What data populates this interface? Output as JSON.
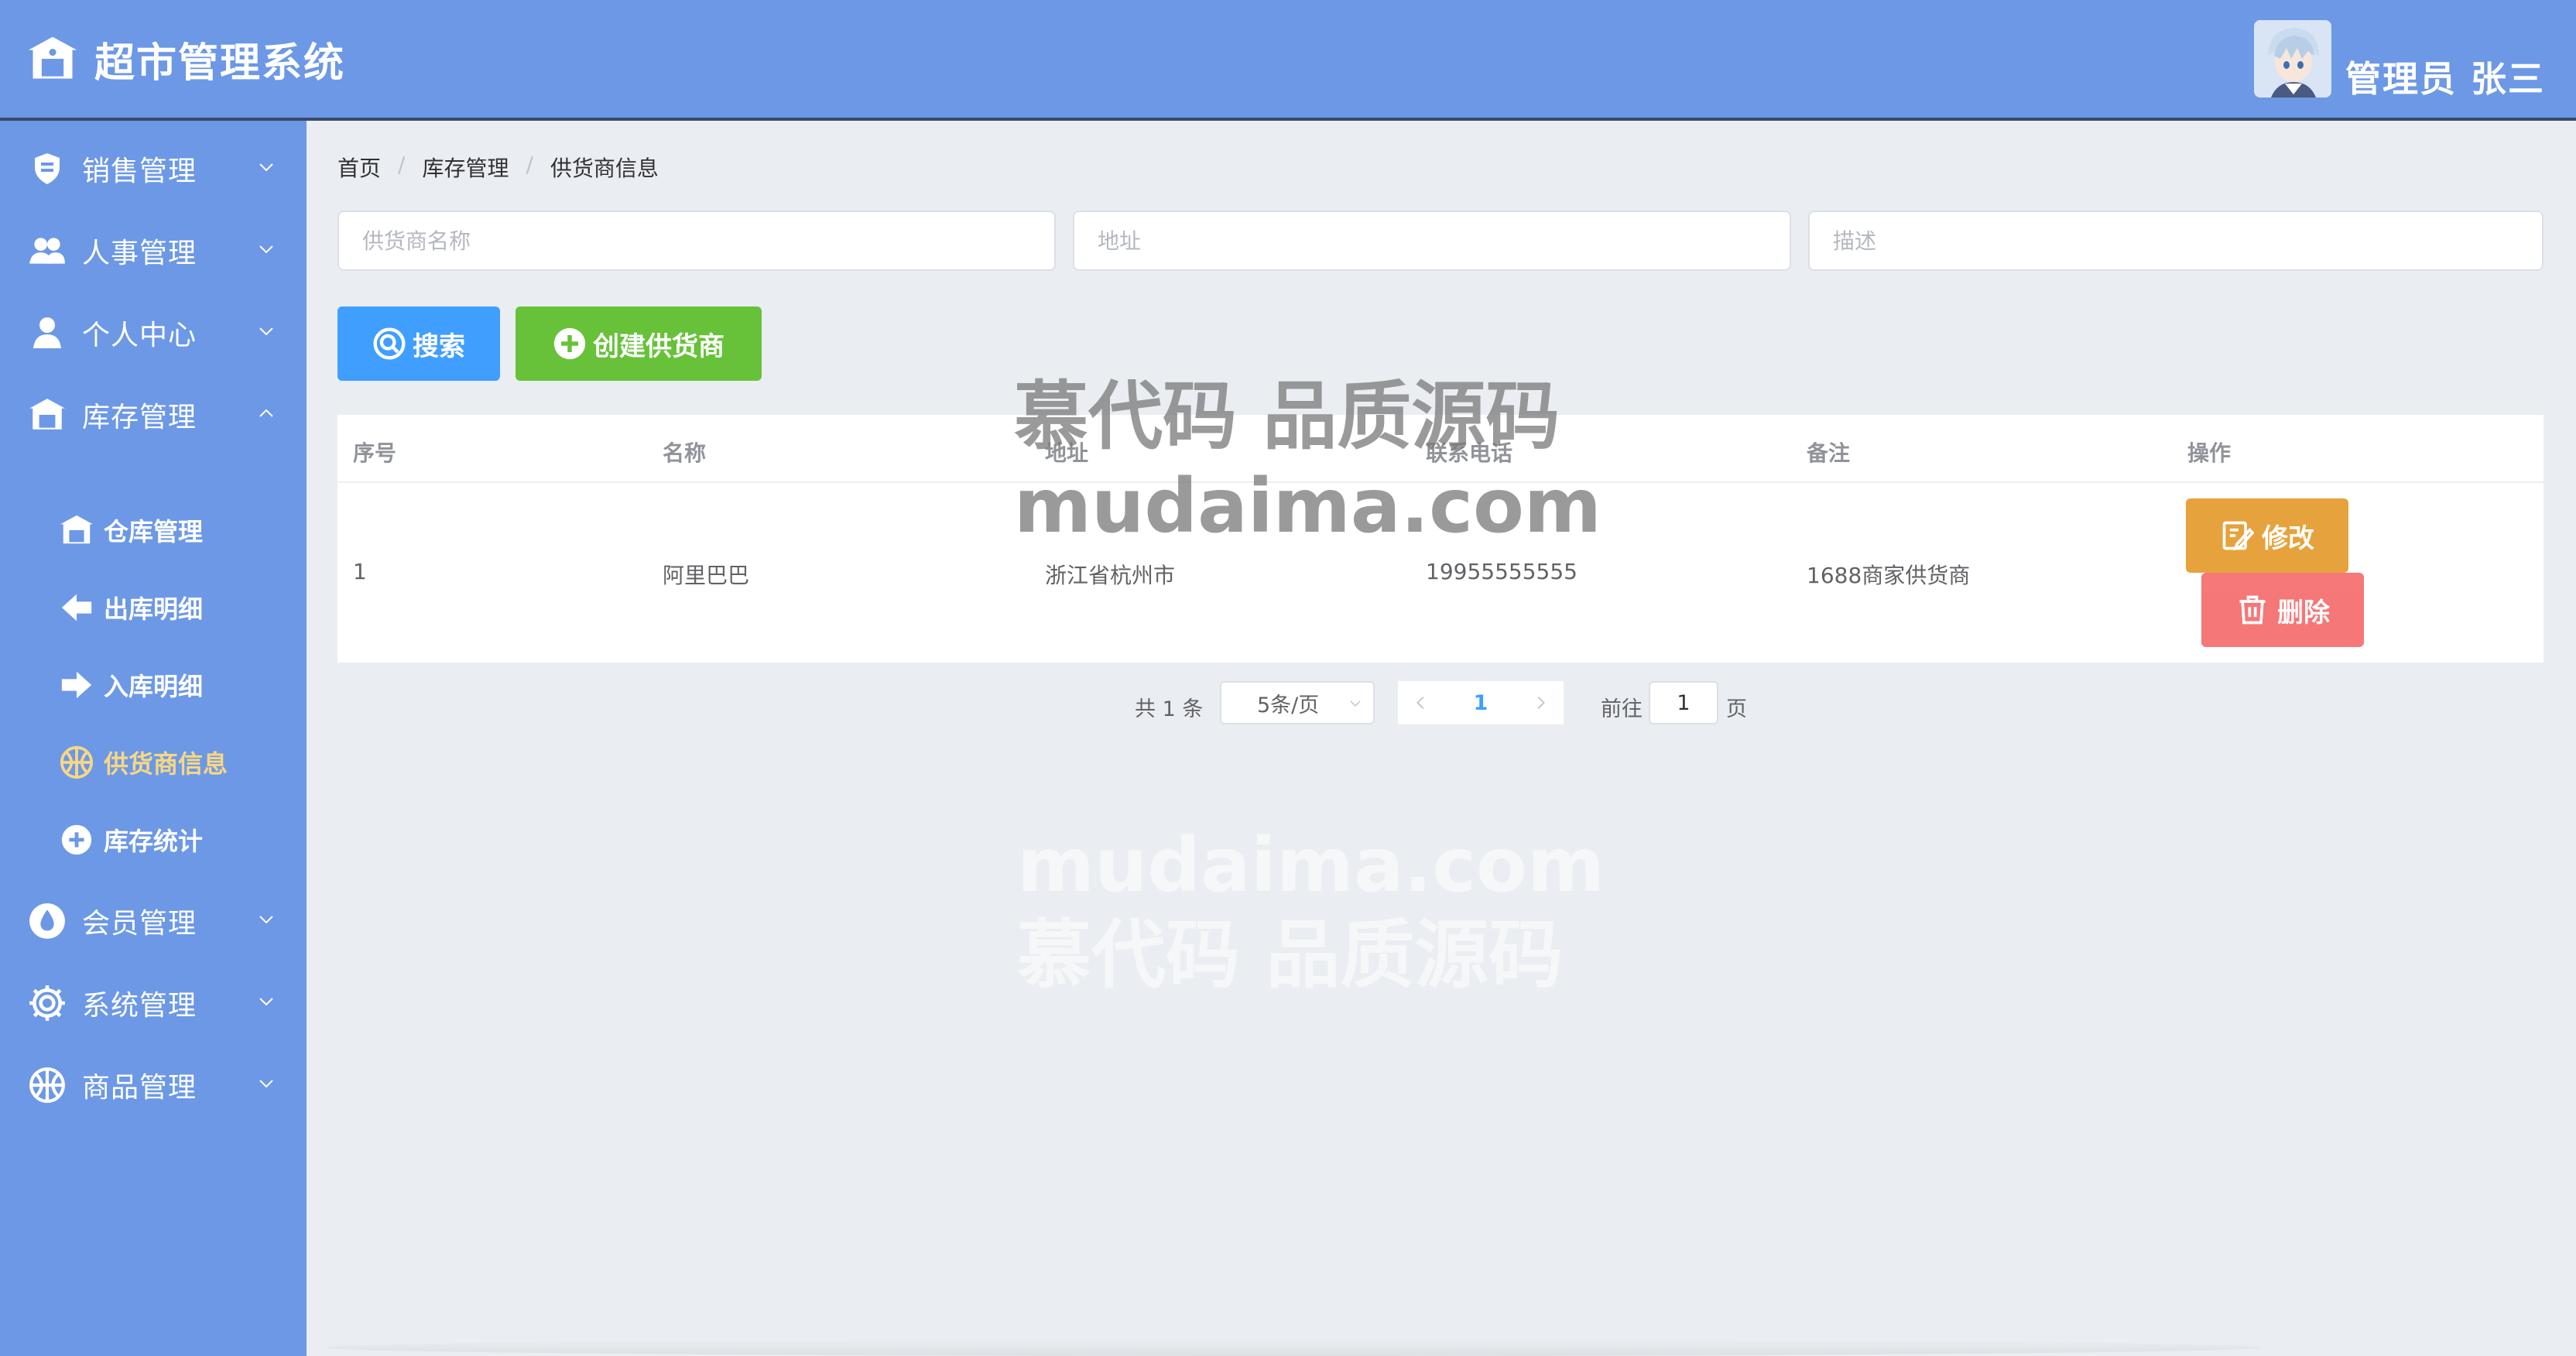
{
  "app": {
    "title": "超市管理系统"
  },
  "header": {
    "user_label": "管理员 张三"
  },
  "sidebar": {
    "menus": [
      {
        "label": "销售管理",
        "icon": "shield-icon"
      },
      {
        "label": "人事管理",
        "icon": "users-icon"
      },
      {
        "label": "个人中心",
        "icon": "user-icon"
      },
      {
        "label": "库存管理",
        "icon": "warehouse-icon",
        "expanded": true
      },
      {
        "label": "会员管理",
        "icon": "drop-icon"
      },
      {
        "label": "系统管理",
        "icon": "gear-icon"
      },
      {
        "label": "商品管理",
        "icon": "basketball-icon"
      }
    ],
    "submenu": [
      {
        "label": "仓库管理",
        "icon": "warehouse-icon"
      },
      {
        "label": "出库明细",
        "icon": "arrow-left-icon"
      },
      {
        "label": "入库明细",
        "icon": "arrow-right-icon"
      },
      {
        "label": "供货商信息",
        "icon": "basketball-icon",
        "active": true
      },
      {
        "label": "库存统计",
        "icon": "plus-circle-icon"
      }
    ]
  },
  "breadcrumb": [
    "首页",
    "库存管理",
    "供货商信息"
  ],
  "search": {
    "name_placeholder": "供货商名称",
    "address_placeholder": "地址",
    "desc_placeholder": "描述",
    "search_label": "搜索",
    "create_label": "创建供货商"
  },
  "table": {
    "headers": [
      "序号",
      "名称",
      "地址",
      "联系电话",
      "备注",
      "操作"
    ],
    "rows": [
      {
        "index": "1",
        "name": "阿里巴巴",
        "address": "浙江省杭州市",
        "phone": "19955555555",
        "remark": "1688商家供货商"
      }
    ],
    "edit_label": "修改",
    "delete_label": "删除"
  },
  "pager": {
    "total": "共 1 条",
    "page_size": "5条/页",
    "current": "1",
    "goto_label": "前往",
    "goto_value": "1",
    "page_unit": "页"
  },
  "watermark": {
    "line1": "慕代码 品质源码",
    "line2": "mudaima.com"
  },
  "colors": {
    "primary_bg": "#6c98e6",
    "search": "#409eff",
    "create": "#67c23a",
    "edit": "#e6a23c",
    "delete": "#f56c6c",
    "active_text": "#f6d785"
  }
}
